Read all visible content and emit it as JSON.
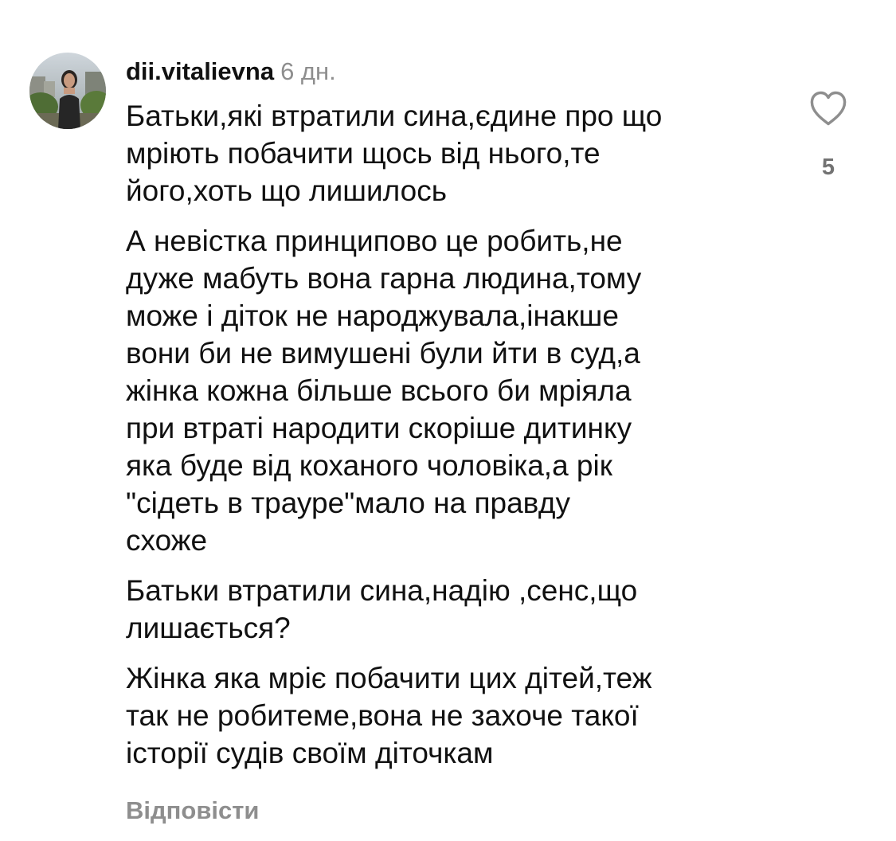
{
  "comment": {
    "username": "dii.vitalievna",
    "time_ago": "6 дн.",
    "paragraphs": [
      "Батьки,які втратили сина,єдине про що\nмріють побачити щось від нього,те\nйого,хоть що лишилось",
      "А невістка принципово це робить,не\nдуже мабуть вона гарна людина,тому\nможе і діток не народжувала,інакше\nвони би не вимушені були йти в суд,а\nжінка кожна більше всього би мріяла\nпри втраті народити скоріше дитинку\nяка буде від коханого чоловіка,а рік\n\"сідеть в трауре\"мало на правду\nсхоже",
      "Батьки втратили сина,надію ,сенс,що\nлишається?",
      "Жінка яка мріє побачити цих дітей,теж\nтак не робитеме,вона не захоче такої\nісторії судів своїм діточкам"
    ],
    "like_icon": "heart-icon",
    "like_count": "5",
    "reply_label": "Відповісти"
  },
  "colors": {
    "text": "#111111",
    "secondary": "#8e8e8e",
    "like_count": "#737373",
    "background": "#ffffff"
  }
}
